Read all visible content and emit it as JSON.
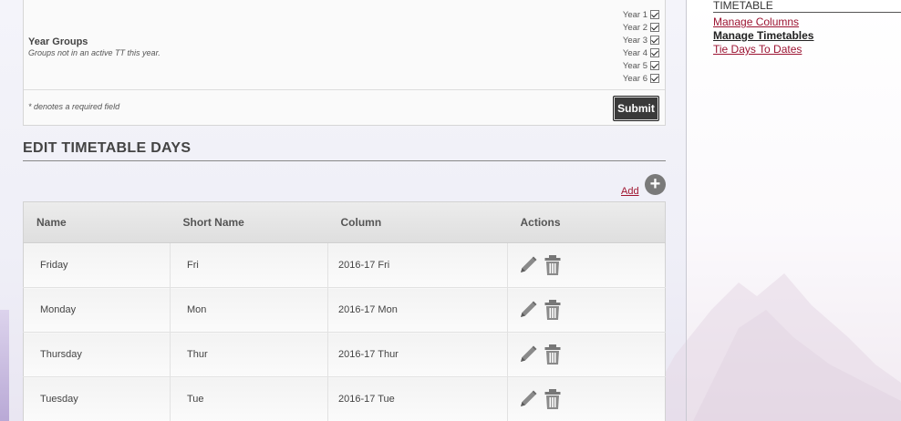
{
  "form": {
    "year_groups_label": "Year Groups",
    "year_groups_sub": "Groups not in an active TT this year.",
    "years": [
      {
        "label": "Year 1",
        "checked": true
      },
      {
        "label": "Year 2",
        "checked": true
      },
      {
        "label": "Year 3",
        "checked": true
      },
      {
        "label": "Year 4",
        "checked": true
      },
      {
        "label": "Year 5",
        "checked": true
      },
      {
        "label": "Year 6",
        "checked": true
      }
    ],
    "required_note": "* denotes a required field",
    "submit_label": "Submit"
  },
  "section": {
    "title": "EDIT TIMETABLE DAYS",
    "add_label": "Add",
    "add_icon": "plus-circle-icon"
  },
  "table": {
    "headers": [
      "Name",
      "Short Name",
      "Column",
      "Actions"
    ],
    "rows": [
      {
        "name": "Friday",
        "short": "Fri",
        "column": "2016-17 Fri"
      },
      {
        "name": "Monday",
        "short": "Mon",
        "column": "2016-17 Mon"
      },
      {
        "name": "Thursday",
        "short": "Thur",
        "column": "2016-17 Thur"
      },
      {
        "name": "Tuesday",
        "short": "Tue",
        "column": "2016-17 Tue"
      }
    ],
    "action_icons": [
      "pencil-icon",
      "trash-icon"
    ]
  },
  "sidebar": {
    "heading": "TIMETABLE",
    "links": [
      {
        "label": "Manage Columns",
        "active": false
      },
      {
        "label": "Manage Timetables",
        "active": true
      },
      {
        "label": "Tie Days To Dates",
        "active": false
      }
    ]
  },
  "colors": {
    "link": "#9c1432",
    "submit_bg": "#3a3a3a",
    "icon_gray": "#7a7a7a"
  }
}
